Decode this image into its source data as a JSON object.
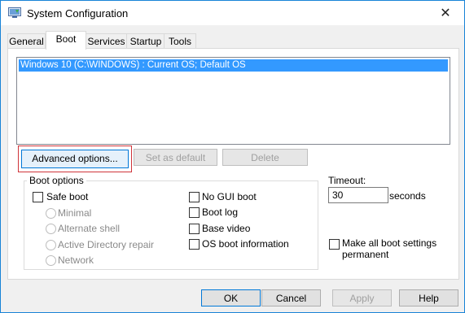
{
  "window": {
    "title": "System Configuration",
    "close_symbol": "✕"
  },
  "tabs": [
    {
      "label": "General"
    },
    {
      "label": "Boot",
      "active": true
    },
    {
      "label": "Services"
    },
    {
      "label": "Startup"
    },
    {
      "label": "Tools"
    }
  ],
  "os_list": {
    "entries": [
      "Windows 10 (C:\\WINDOWS) : Current OS; Default OS"
    ],
    "selected_index": 0
  },
  "actions": {
    "advanced": "Advanced options...",
    "set_default": "Set as default",
    "delete": "Delete"
  },
  "boot_options": {
    "legend": "Boot options",
    "safe_boot": "Safe boot",
    "radio_minimal": "Minimal",
    "radio_alt_shell": "Alternate shell",
    "radio_ad_repair": "Active Directory repair",
    "radio_network": "Network",
    "no_gui_boot": "No GUI boot",
    "boot_log": "Boot log",
    "base_video": "Base video",
    "os_boot_info": "OS boot information"
  },
  "timeout": {
    "label": "Timeout:",
    "value": "30",
    "unit": "seconds"
  },
  "make_permanent": "Make all boot settings permanent",
  "make_permanent_line1": "Make all boot settings",
  "make_permanent_line2": "permanent",
  "footer": {
    "ok": "OK",
    "cancel": "Cancel",
    "apply": "Apply",
    "help": "Help"
  },
  "colors": {
    "accent": "#0078d7",
    "selection": "#3399ff",
    "highlight_outline": "#d0343a"
  }
}
